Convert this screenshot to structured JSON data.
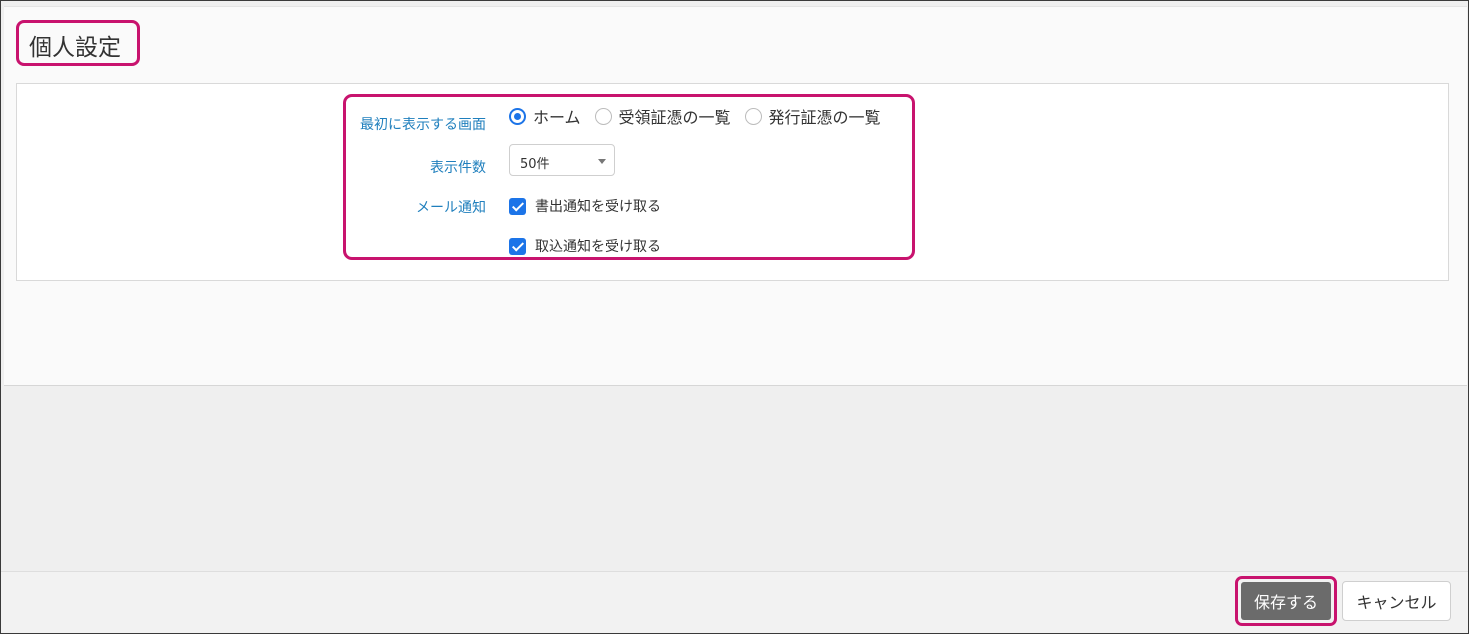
{
  "page": {
    "title": "個人設定"
  },
  "settings": {
    "initial_screen": {
      "label": "最初に表示する画面",
      "options": [
        {
          "label": "ホーム",
          "checked": true
        },
        {
          "label": "受領証憑の一覧",
          "checked": false
        },
        {
          "label": "発行証憑の一覧",
          "checked": false
        }
      ]
    },
    "display_count": {
      "label": "表示件数",
      "selected": "50件"
    },
    "mail_notification": {
      "label": "メール通知",
      "options": [
        {
          "label": "書出通知を受け取る",
          "checked": true
        },
        {
          "label": "取込通知を受け取る",
          "checked": true
        }
      ]
    }
  },
  "footer": {
    "save_label": "保存する",
    "cancel_label": "キャンセル"
  },
  "colors": {
    "accent_highlight": "#c8136e",
    "label_blue": "#1f7fbd",
    "control_blue": "#1c74e8",
    "save_button_bg": "#6b6b6b"
  }
}
